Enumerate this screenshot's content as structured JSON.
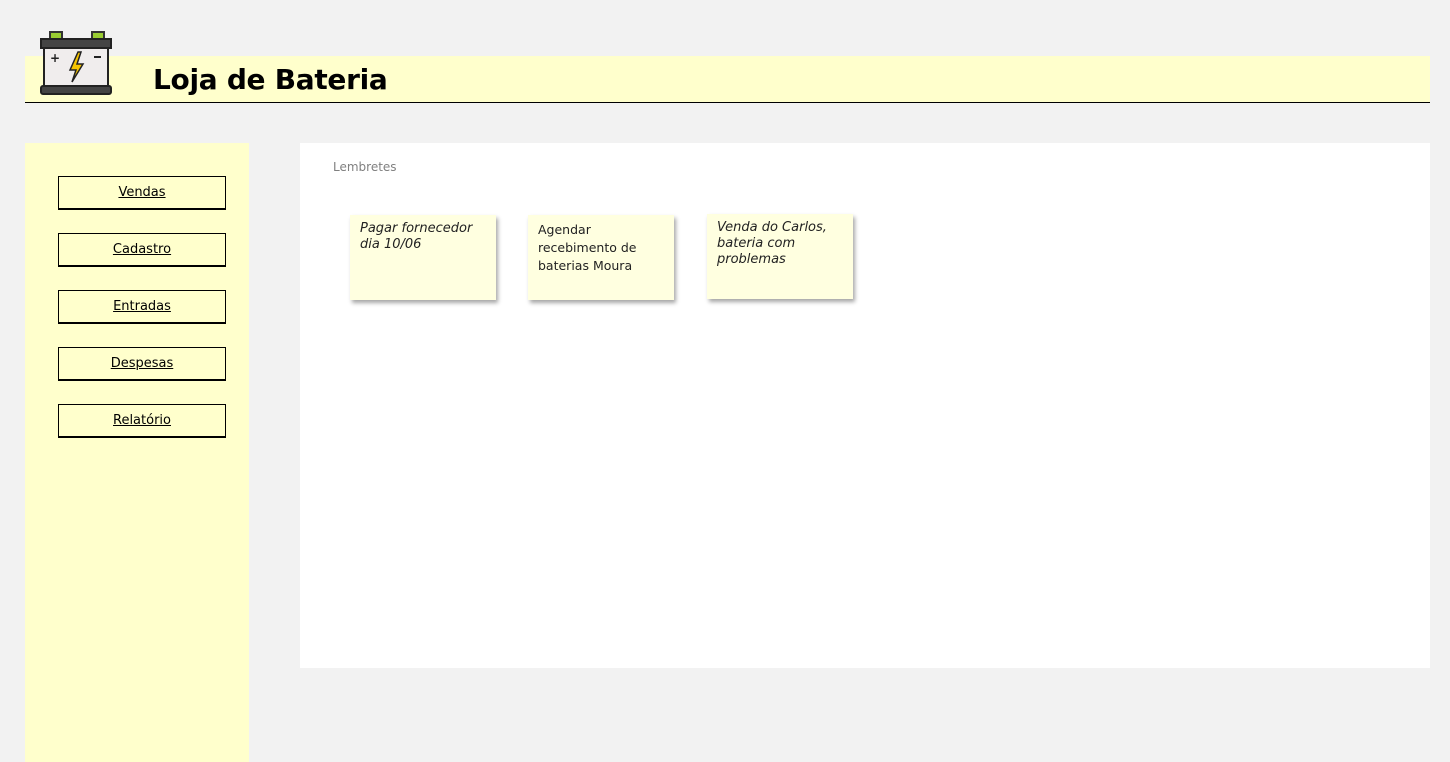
{
  "header": {
    "title": "Loja de Bateria",
    "logo_icon": "battery-icon"
  },
  "sidebar": {
    "items": [
      {
        "label": "Vendas"
      },
      {
        "label": "Cadastro"
      },
      {
        "label": "Entradas"
      },
      {
        "label": "Despesas"
      },
      {
        "label": "Relatório"
      }
    ]
  },
  "main": {
    "title": "Lembretes",
    "notes": [
      {
        "text": "Pagar fornecedor dia 10/06"
      },
      {
        "text": "Agendar recebimento de baterias Moura"
      },
      {
        "text": "Venda do Carlos, bateria com problemas"
      }
    ]
  },
  "colors": {
    "background": "#f2f2f2",
    "accent_yellow": "#ffffcc",
    "note_yellow": "#ffffe0",
    "panel": "#ffffff"
  }
}
